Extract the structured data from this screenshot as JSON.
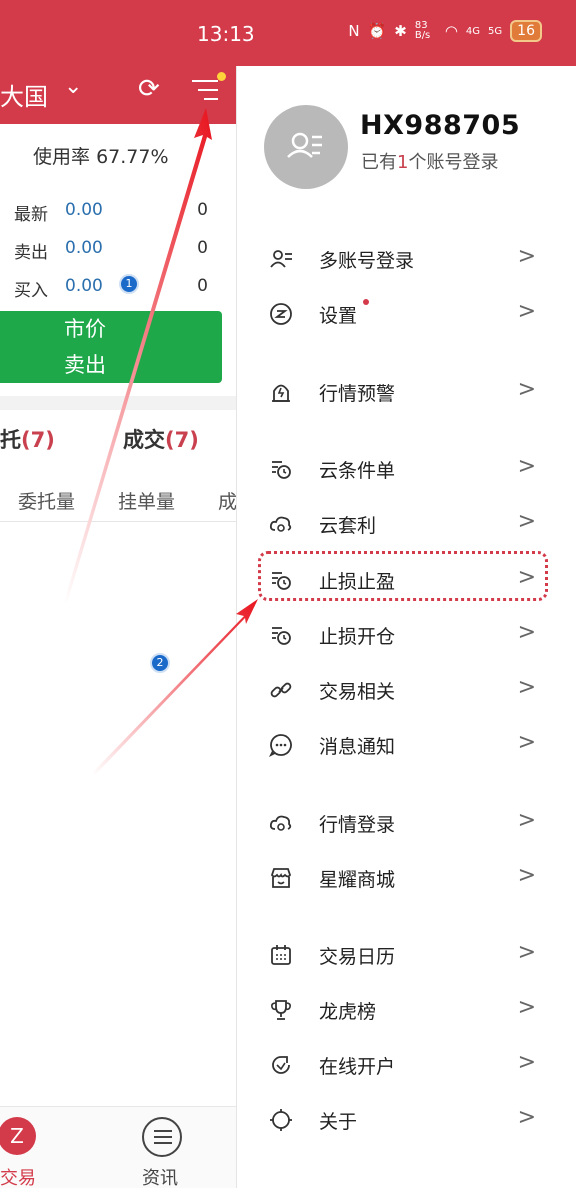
{
  "status_bar": {
    "time": "13:13",
    "network_speed": "83 B/s",
    "signal_4g": "4G",
    "signal_5g": "5G",
    "battery": "16"
  },
  "background_app": {
    "header_title": "大国",
    "usage_label": "使用率",
    "usage_value": "67.77%",
    "quotes": [
      {
        "label": "最新",
        "value": "0.00",
        "count": "0"
      },
      {
        "label": "卖出",
        "value": "0.00",
        "count": "0"
      },
      {
        "label": "买入",
        "value": "0.00",
        "count": "0"
      }
    ],
    "sell_button": {
      "line1": "市价",
      "line2": "卖出"
    },
    "tabs": [
      {
        "label": "托",
        "count": "(7)"
      },
      {
        "label": "成交",
        "count": "(7)"
      }
    ],
    "columns": [
      "委托量",
      "挂单量",
      "成"
    ],
    "bottom_nav": [
      {
        "label": "交易"
      },
      {
        "label": "资讯"
      }
    ]
  },
  "drawer": {
    "account_id": "HX988705",
    "account_sub_prefix": "已有",
    "account_sub_count": "1",
    "account_sub_suffix": "个账号登录",
    "items": [
      {
        "label": "多账号登录",
        "icon": "multi-account-icon"
      },
      {
        "label": "设置",
        "icon": "settings-icon"
      },
      {
        "label": "行情预警",
        "icon": "alert-bell-icon"
      },
      {
        "label": "云条件单",
        "icon": "condition-order-icon"
      },
      {
        "label": "云套利",
        "icon": "cloud-arbitrage-icon"
      },
      {
        "label": "止损止盈",
        "icon": "stop-loss-profit-icon"
      },
      {
        "label": "止损开仓",
        "icon": "stop-loss-open-icon"
      },
      {
        "label": "交易相关",
        "icon": "link-icon"
      },
      {
        "label": "消息通知",
        "icon": "message-icon"
      },
      {
        "label": "行情登录",
        "icon": "cloud-login-icon"
      },
      {
        "label": "星耀商城",
        "icon": "store-icon"
      },
      {
        "label": "交易日历",
        "icon": "calendar-icon"
      },
      {
        "label": "龙虎榜",
        "icon": "trophy-icon"
      },
      {
        "label": "在线开户",
        "icon": "open-account-icon"
      },
      {
        "label": "关于",
        "icon": "about-icon"
      }
    ]
  },
  "annotations": {
    "badge_1": "1",
    "badge_2": "2",
    "arrow_color": "#e8141e",
    "highlight_color": "#d33a4a"
  }
}
